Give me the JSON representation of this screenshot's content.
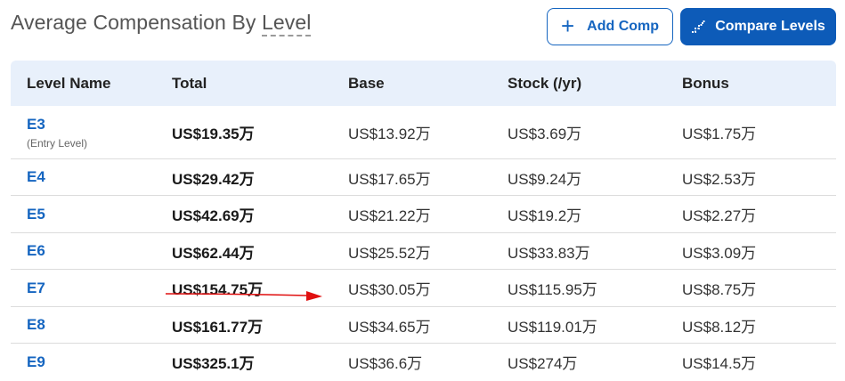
{
  "header": {
    "title_prefix": "Average Compensation By ",
    "title_level": "Level",
    "add_button": "Add Comp",
    "compare_button": "Compare Levels"
  },
  "columns": [
    "Level Name",
    "Total",
    "Base",
    "Stock (/yr)",
    "Bonus"
  ],
  "rows": [
    {
      "level": "E3",
      "sublabel": "(Entry Level)",
      "total": "US$19.35万",
      "base": "US$13.92万",
      "stock": "US$3.69万",
      "bonus": "US$1.75万"
    },
    {
      "level": "E4",
      "sublabel": "",
      "total": "US$29.42万",
      "base": "US$17.65万",
      "stock": "US$9.24万",
      "bonus": "US$2.53万"
    },
    {
      "level": "E5",
      "sublabel": "",
      "total": "US$42.69万",
      "base": "US$21.22万",
      "stock": "US$19.2万",
      "bonus": "US$2.27万"
    },
    {
      "level": "E6",
      "sublabel": "",
      "total": "US$62.44万",
      "base": "US$25.52万",
      "stock": "US$33.83万",
      "bonus": "US$3.09万"
    },
    {
      "level": "E7",
      "sublabel": "",
      "total": "US$154.75万",
      "base": "US$30.05万",
      "stock": "US$115.95万",
      "bonus": "US$8.75万"
    },
    {
      "level": "E8",
      "sublabel": "",
      "total": "US$161.77万",
      "base": "US$34.65万",
      "stock": "US$119.01万",
      "bonus": "US$8.12万"
    },
    {
      "level": "E9",
      "sublabel": "",
      "total": "US$325.1万",
      "base": "US$36.6万",
      "stock": "US$274万",
      "bonus": "US$14.5万"
    }
  ],
  "colors": {
    "accent": "#1565c0",
    "header_bg": "#e8f0fb",
    "arrow": "#e01010"
  }
}
